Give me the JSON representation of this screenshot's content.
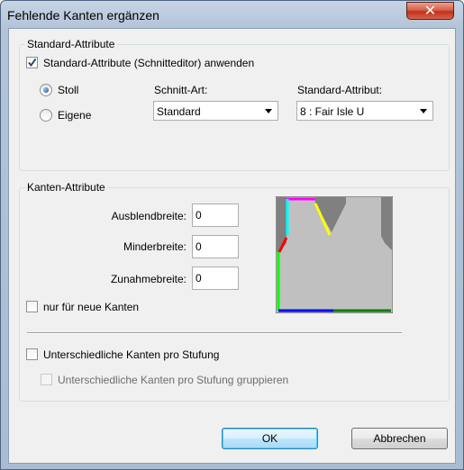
{
  "window": {
    "title": "Fehlende Kanten ergänzen",
    "close_glyph": "✕"
  },
  "standard_group": {
    "legend": "Standard-Attribute",
    "apply_checkbox": {
      "label": "Standard-Attribute (Schnitteditor) anwenden",
      "checked": true
    },
    "radios": [
      {
        "label": "Stoll",
        "selected": true
      },
      {
        "label": "Eigene",
        "selected": false
      }
    ],
    "schnitt_art": {
      "label": "Schnitt-Art:",
      "value": "Standard"
    },
    "standard_attribut": {
      "label": "Standard-Attribut:",
      "value": "8 : Fair Isle U"
    }
  },
  "kanten_group": {
    "legend": "Kanten-Attribute",
    "fields": [
      {
        "label": "Ausblendbreite:",
        "value": "0"
      },
      {
        "label": "Minderbreite:",
        "value": "0"
      },
      {
        "label": "Zunahmebreite:",
        "value": "0"
      }
    ],
    "neue_kanten_checkbox": {
      "label": "nur für neue Kanten",
      "checked": false
    },
    "pro_stufung_checkbox": {
      "label": "Unterschiedliche Kanten pro Stufung",
      "checked": false
    },
    "gruppieren_checkbox": {
      "label": "Unterschiedliche Kanten pro Stufung gruppieren",
      "checked": false,
      "disabled": true
    }
  },
  "buttons": {
    "ok": "OK",
    "cancel": "Abbrechen"
  },
  "colors": {
    "preview_bg": "#c0c0c0",
    "preview_dark": "#808080",
    "edge_magenta": "#ff00ff",
    "edge_cyan": "#00ffff",
    "edge_yellow": "#ffff00",
    "edge_red": "#ff0000",
    "edge_green": "#00ff00",
    "edge_blue": "#0000ff",
    "edge_darkgreen": "#008000"
  }
}
